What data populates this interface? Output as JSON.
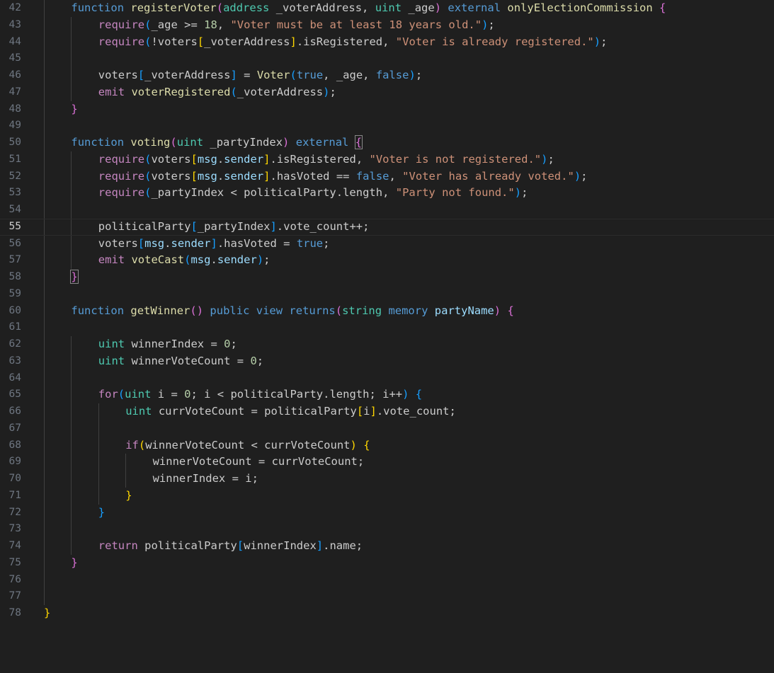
{
  "editor": {
    "language": "solidity",
    "current_line": 55,
    "colors": {
      "background": "#1f1f1f",
      "line_number": "#6e7681",
      "keyword": "#569cd6",
      "control": "#c586c0",
      "function": "#dcdcaa",
      "type": "#4ec9b0",
      "variable": "#9cdcfe",
      "string": "#ce9178",
      "number": "#b5cea8",
      "bracket_1": "#ffd700",
      "bracket_2": "#da70d6",
      "bracket_3": "#179fff"
    },
    "lines": [
      {
        "n": "42",
        "indent": 1,
        "tokens": [
          [
            "kw",
            "function"
          ],
          [
            "tx",
            " "
          ],
          [
            "fn",
            "registerVoter"
          ],
          [
            "b2",
            "("
          ],
          [
            "ty",
            "address"
          ],
          [
            "tx",
            " _voterAddress, "
          ],
          [
            "ty",
            "uint"
          ],
          [
            "tx",
            " _age"
          ],
          [
            "b2",
            ")"
          ],
          [
            "tx",
            " "
          ],
          [
            "kw",
            "external"
          ],
          [
            "tx",
            " "
          ],
          [
            "fn",
            "onlyElectionCommission"
          ],
          [
            "tx",
            " "
          ],
          [
            "b2",
            "{"
          ]
        ]
      },
      {
        "n": "43",
        "indent": 2,
        "tokens": [
          [
            "ctl",
            "require"
          ],
          [
            "b3",
            "("
          ],
          [
            "tx",
            "_age >= "
          ],
          [
            "num",
            "18"
          ],
          [
            "tx",
            ", "
          ],
          [
            "str",
            "\"Voter must be at least 18 years old.\""
          ],
          [
            "b3",
            ")"
          ],
          [
            "tx",
            ";"
          ]
        ]
      },
      {
        "n": "44",
        "indent": 2,
        "tokens": [
          [
            "ctl",
            "require"
          ],
          [
            "b3",
            "("
          ],
          [
            "tx",
            "!voters"
          ],
          [
            "b1",
            "["
          ],
          [
            "tx",
            "_voterAddress"
          ],
          [
            "b1",
            "]"
          ],
          [
            "tx",
            ".isRegistered, "
          ],
          [
            "str",
            "\"Voter is already registered.\""
          ],
          [
            "b3",
            ")"
          ],
          [
            "tx",
            ";"
          ]
        ]
      },
      {
        "n": "45",
        "indent": 0,
        "tokens": []
      },
      {
        "n": "46",
        "indent": 2,
        "tokens": [
          [
            "tx",
            "voters"
          ],
          [
            "b3",
            "["
          ],
          [
            "tx",
            "_voterAddress"
          ],
          [
            "b3",
            "]"
          ],
          [
            "tx",
            " = "
          ],
          [
            "fn",
            "Voter"
          ],
          [
            "b3",
            "("
          ],
          [
            "kw",
            "true"
          ],
          [
            "tx",
            ", _age, "
          ],
          [
            "kw",
            "false"
          ],
          [
            "b3",
            ")"
          ],
          [
            "tx",
            ";"
          ]
        ]
      },
      {
        "n": "47",
        "indent": 2,
        "tokens": [
          [
            "ctl",
            "emit"
          ],
          [
            "tx",
            " "
          ],
          [
            "fn",
            "voterRegistered"
          ],
          [
            "b3",
            "("
          ],
          [
            "tx",
            "_voterAddress"
          ],
          [
            "b3",
            ")"
          ],
          [
            "tx",
            ";"
          ]
        ]
      },
      {
        "n": "48",
        "indent": 1,
        "tokens": [
          [
            "b2",
            "}"
          ]
        ]
      },
      {
        "n": "49",
        "indent": 0,
        "tokens": []
      },
      {
        "n": "50",
        "indent": 1,
        "tokens": [
          [
            "kw",
            "function"
          ],
          [
            "tx",
            " "
          ],
          [
            "fn",
            "voting"
          ],
          [
            "b2",
            "("
          ],
          [
            "ty",
            "uint"
          ],
          [
            "tx",
            " _partyIndex"
          ],
          [
            "b2",
            ")"
          ],
          [
            "tx",
            " "
          ],
          [
            "kw",
            "external"
          ],
          [
            "tx",
            " "
          ],
          [
            "b2bm",
            "{"
          ]
        ]
      },
      {
        "n": "51",
        "indent": 2,
        "tokens": [
          [
            "ctl",
            "require"
          ],
          [
            "b3",
            "("
          ],
          [
            "tx",
            "voters"
          ],
          [
            "b1",
            "["
          ],
          [
            "var",
            "msg"
          ],
          [
            "tx",
            "."
          ],
          [
            "var",
            "sender"
          ],
          [
            "b1",
            "]"
          ],
          [
            "tx",
            ".isRegistered, "
          ],
          [
            "str",
            "\"Voter is not registered.\""
          ],
          [
            "b3",
            ")"
          ],
          [
            "tx",
            ";"
          ]
        ]
      },
      {
        "n": "52",
        "indent": 2,
        "tokens": [
          [
            "ctl",
            "require"
          ],
          [
            "b3",
            "("
          ],
          [
            "tx",
            "voters"
          ],
          [
            "b1",
            "["
          ],
          [
            "var",
            "msg"
          ],
          [
            "tx",
            "."
          ],
          [
            "var",
            "sender"
          ],
          [
            "b1",
            "]"
          ],
          [
            "tx",
            ".hasVoted == "
          ],
          [
            "kw",
            "false"
          ],
          [
            "tx",
            ", "
          ],
          [
            "str",
            "\"Voter has already voted.\""
          ],
          [
            "b3",
            ")"
          ],
          [
            "tx",
            ";"
          ]
        ]
      },
      {
        "n": "53",
        "indent": 2,
        "tokens": [
          [
            "ctl",
            "require"
          ],
          [
            "b3",
            "("
          ],
          [
            "tx",
            "_partyIndex < politicalParty.length, "
          ],
          [
            "str",
            "\"Party not found.\""
          ],
          [
            "b3",
            ")"
          ],
          [
            "tx",
            ";"
          ]
        ]
      },
      {
        "n": "54",
        "indent": 0,
        "tokens": []
      },
      {
        "n": "55",
        "indent": 2,
        "tokens": [
          [
            "tx",
            "politicalParty"
          ],
          [
            "b3",
            "["
          ],
          [
            "tx",
            "_partyIndex"
          ],
          [
            "b3",
            "]"
          ],
          [
            "tx",
            ".vote_count++;"
          ]
        ]
      },
      {
        "n": "56",
        "indent": 2,
        "tokens": [
          [
            "tx",
            "voters"
          ],
          [
            "b3",
            "["
          ],
          [
            "var",
            "msg"
          ],
          [
            "tx",
            "."
          ],
          [
            "var",
            "sender"
          ],
          [
            "b3",
            "]"
          ],
          [
            "tx",
            ".hasVoted = "
          ],
          [
            "kw",
            "true"
          ],
          [
            "tx",
            ";"
          ]
        ]
      },
      {
        "n": "57",
        "indent": 2,
        "tokens": [
          [
            "ctl",
            "emit"
          ],
          [
            "tx",
            " "
          ],
          [
            "fn",
            "voteCast"
          ],
          [
            "b3",
            "("
          ],
          [
            "var",
            "msg"
          ],
          [
            "tx",
            "."
          ],
          [
            "var",
            "sender"
          ],
          [
            "b3",
            ")"
          ],
          [
            "tx",
            ";"
          ]
        ]
      },
      {
        "n": "58",
        "indent": 1,
        "tokens": [
          [
            "b2bm",
            "}"
          ]
        ]
      },
      {
        "n": "59",
        "indent": 0,
        "tokens": []
      },
      {
        "n": "60",
        "indent": 1,
        "tokens": [
          [
            "kw",
            "function"
          ],
          [
            "tx",
            " "
          ],
          [
            "fn",
            "getWinner"
          ],
          [
            "b2",
            "()"
          ],
          [
            "tx",
            " "
          ],
          [
            "kw",
            "public"
          ],
          [
            "tx",
            " "
          ],
          [
            "kw",
            "view"
          ],
          [
            "tx",
            " "
          ],
          [
            "kw",
            "returns"
          ],
          [
            "b2",
            "("
          ],
          [
            "ty",
            "string"
          ],
          [
            "tx",
            " "
          ],
          [
            "kw",
            "memory"
          ],
          [
            "tx",
            " "
          ],
          [
            "var",
            "partyName"
          ],
          [
            "b2",
            ")"
          ],
          [
            "tx",
            " "
          ],
          [
            "b2",
            "{"
          ]
        ]
      },
      {
        "n": "61",
        "indent": 0,
        "tokens": []
      },
      {
        "n": "62",
        "indent": 2,
        "tokens": [
          [
            "ty",
            "uint"
          ],
          [
            "tx",
            " winnerIndex = "
          ],
          [
            "num",
            "0"
          ],
          [
            "tx",
            ";"
          ]
        ]
      },
      {
        "n": "63",
        "indent": 2,
        "tokens": [
          [
            "ty",
            "uint"
          ],
          [
            "tx",
            " winnerVoteCount = "
          ],
          [
            "num",
            "0"
          ],
          [
            "tx",
            ";"
          ]
        ]
      },
      {
        "n": "64",
        "indent": 0,
        "tokens": []
      },
      {
        "n": "65",
        "indent": 2,
        "tokens": [
          [
            "ctl",
            "for"
          ],
          [
            "b3",
            "("
          ],
          [
            "ty",
            "uint"
          ],
          [
            "tx",
            " i = "
          ],
          [
            "num",
            "0"
          ],
          [
            "tx",
            "; i < politicalParty.length; i++"
          ],
          [
            "b3",
            ")"
          ],
          [
            "tx",
            " "
          ],
          [
            "b3",
            "{"
          ]
        ]
      },
      {
        "n": "66",
        "indent": 3,
        "tokens": [
          [
            "ty",
            "uint"
          ],
          [
            "tx",
            " currVoteCount = politicalParty"
          ],
          [
            "b1",
            "["
          ],
          [
            "tx",
            "i"
          ],
          [
            "b1",
            "]"
          ],
          [
            "tx",
            ".vote_count;"
          ]
        ]
      },
      {
        "n": "67",
        "indent": 0,
        "tokens": []
      },
      {
        "n": "68",
        "indent": 3,
        "tokens": [
          [
            "ctl",
            "if"
          ],
          [
            "b1",
            "("
          ],
          [
            "tx",
            "winnerVoteCount < currVoteCount"
          ],
          [
            "b1",
            ")"
          ],
          [
            "tx",
            " "
          ],
          [
            "b1",
            "{"
          ]
        ]
      },
      {
        "n": "69",
        "indent": 4,
        "tokens": [
          [
            "tx",
            "winnerVoteCount = currVoteCount;"
          ]
        ]
      },
      {
        "n": "70",
        "indent": 4,
        "tokens": [
          [
            "tx",
            "winnerIndex = i;"
          ]
        ]
      },
      {
        "n": "71",
        "indent": 3,
        "tokens": [
          [
            "b1",
            "}"
          ]
        ]
      },
      {
        "n": "72",
        "indent": 2,
        "tokens": [
          [
            "b3",
            "}"
          ]
        ]
      },
      {
        "n": "73",
        "indent": 0,
        "tokens": []
      },
      {
        "n": "74",
        "indent": 2,
        "tokens": [
          [
            "ctl",
            "return"
          ],
          [
            "tx",
            " politicalParty"
          ],
          [
            "b3",
            "["
          ],
          [
            "tx",
            "winnerIndex"
          ],
          [
            "b3",
            "]"
          ],
          [
            "tx",
            ".name;"
          ]
        ]
      },
      {
        "n": "75",
        "indent": 1,
        "tokens": [
          [
            "b2",
            "}"
          ]
        ]
      },
      {
        "n": "76",
        "indent": 0,
        "tokens": []
      },
      {
        "n": "77",
        "indent": 0,
        "tokens": []
      },
      {
        "n": "78",
        "indent": 0,
        "tokens": [
          [
            "b1",
            "}"
          ]
        ]
      }
    ]
  }
}
